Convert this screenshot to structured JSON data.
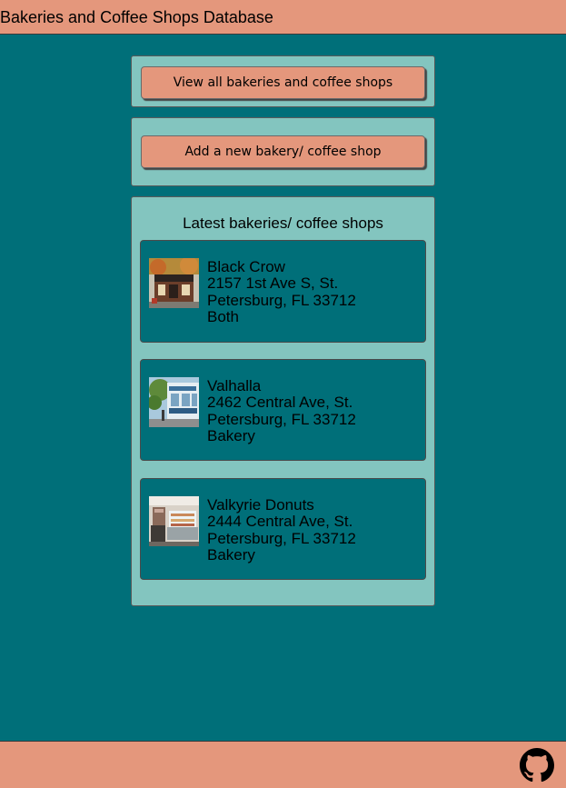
{
  "header": {
    "title": "Bakeries and Coffee Shops Database"
  },
  "actions": {
    "view_all_label": "View all bakeries and coffee shops",
    "add_new_label": "Add a new bakery/ coffee shop"
  },
  "latest": {
    "heading": "Latest bakeries/ coffee shops",
    "shops": [
      {
        "name": "Black Crow",
        "address": "2157 1st Ave S, St. Petersburg, FL 33712",
        "type": "Both",
        "photo": "storefront-photo-black-crow"
      },
      {
        "name": "Valhalla",
        "address": "2462 Central Ave, St. Petersburg, FL 33712",
        "type": "Bakery",
        "photo": "storefront-photo-valhalla"
      },
      {
        "name": "Valkyrie Donuts",
        "address": "2444 Central Ave, St. Petersburg, FL 33712",
        "type": "Bakery",
        "photo": "storefront-photo-valkyrie-donuts"
      }
    ]
  },
  "footer": {
    "icon": "github-icon"
  },
  "colors": {
    "background": "#006f79",
    "bar": "#e4977c",
    "panel": "#83c5bf",
    "card": "#006f79"
  }
}
